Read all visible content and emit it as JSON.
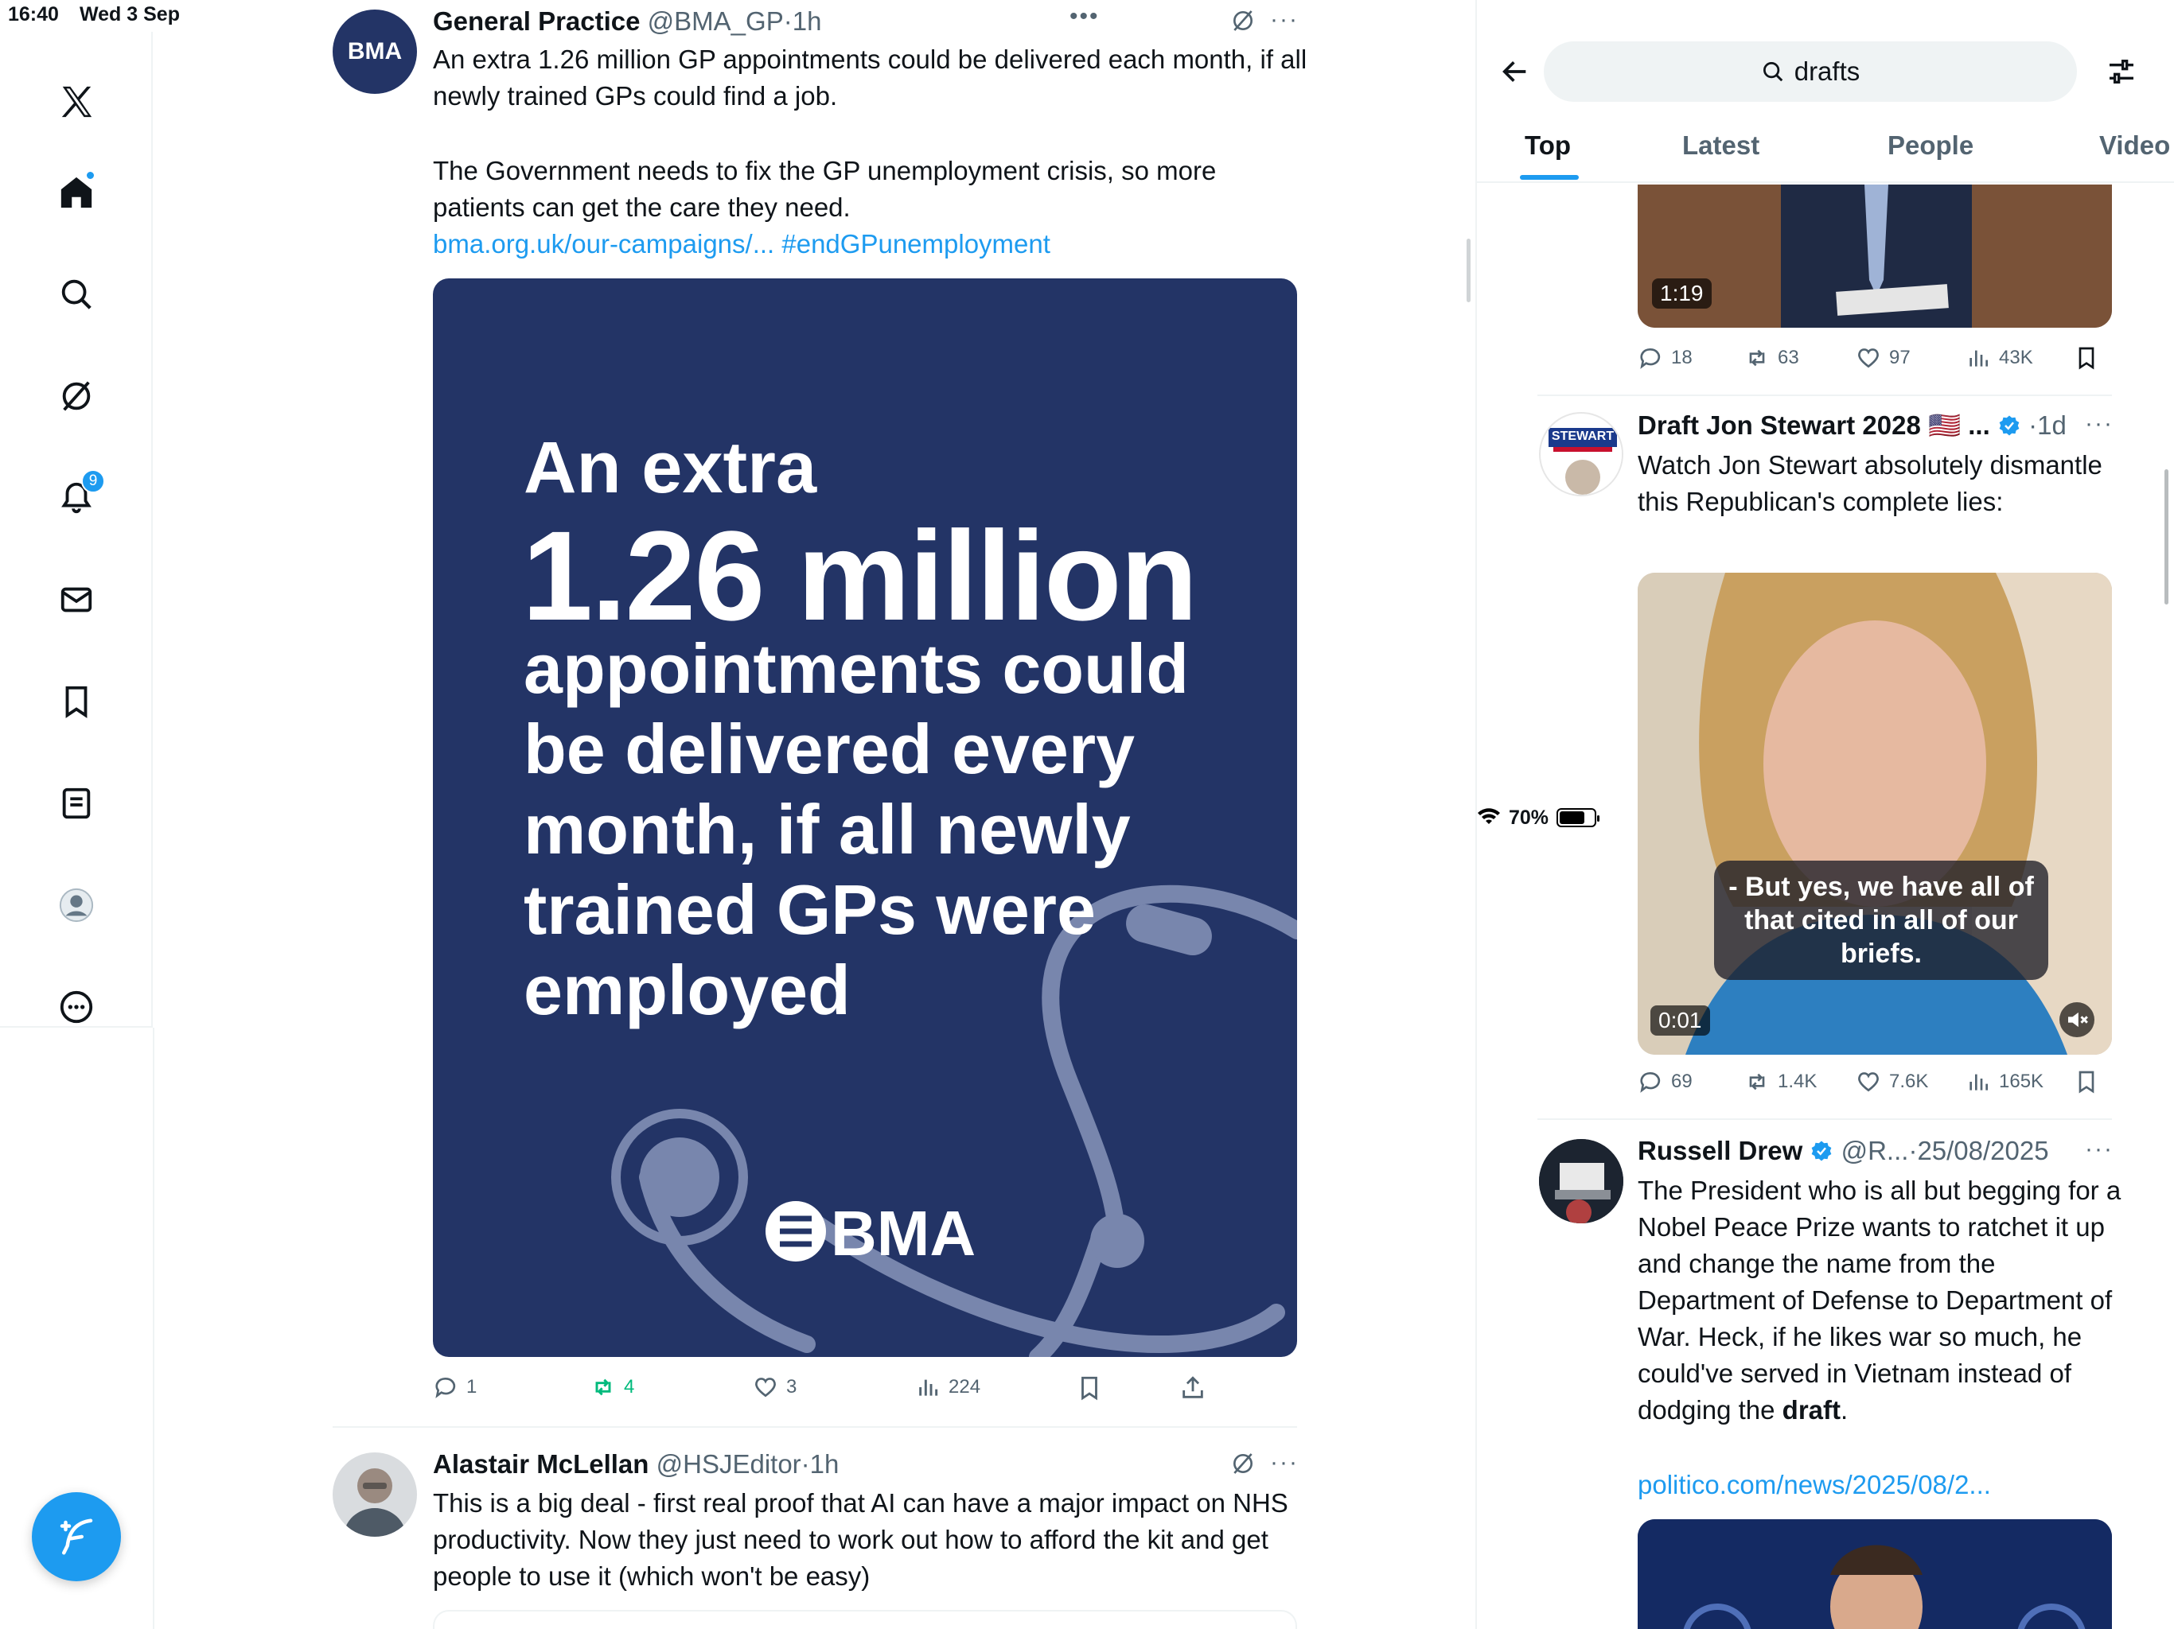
{
  "status": {
    "time": "16:40",
    "date": "Wed 3 Sep",
    "battery": "70%"
  },
  "nav": {
    "notifications_badge": "9"
  },
  "tweet1": {
    "name": "General Practice",
    "handle": "@BMA_GP",
    "time": "1h",
    "avatar_text": "BMA",
    "text1": "An extra 1.26 million GP appointments could be delivered each month, if all newly trained GPs could find a job.",
    "text2": "The Government needs to fix the GP unemployment crisis, so more patients can get the care they need.",
    "link": "bma.org.uk/our-campaigns/...",
    "hashtag": "#endGPunemployment",
    "card": {
      "line1": "An extra",
      "line2": "1.26 million",
      "line3": "appointments could be delivered every month, if all newly trained GPs were employed",
      "logo": "BMA"
    },
    "stats": {
      "replies": "1",
      "reposts": "4",
      "likes": "3",
      "views": "224"
    }
  },
  "tweet2": {
    "name": "Alastair McLellan",
    "handle": "@HSJEditor",
    "time": "1h",
    "text": "This is a big deal - first real proof that AI can have a major impact on NHS productivity. Now they just need to work out how to afford the kit and get people to use it (which won't be easy)"
  },
  "search": {
    "query": "drafts"
  },
  "tabs": [
    "Top",
    "Latest",
    "People",
    "Video"
  ],
  "r0": {
    "video_time": "1:19",
    "stats": {
      "replies": "18",
      "reposts": "63",
      "likes": "97",
      "views": "43K"
    }
  },
  "r1": {
    "name": "Draft Jon Stewart 2028",
    "flag": "🇺🇸 ...",
    "time": "1d",
    "text": "Watch Jon Stewart absolutely dismantle this Republican's complete lies:",
    "avatar_text": "STEWART",
    "subtitle": "- But yes, we have all of that cited in all of our briefs.",
    "video_time": "0:01",
    "stats": {
      "replies": "69",
      "reposts": "1.4K",
      "likes": "7.6K",
      "views": "165K"
    }
  },
  "r2": {
    "name": "Russell Drew",
    "handle": "@R...",
    "time": "25/08/2025",
    "text_before": "The President who is all but begging for a Nobel Peace Prize wants to ratchet it up and change the name from the Department of Defense to Department of War. Heck, if he likes war so much, he could've served in Vietnam instead of dodging the ",
    "text_bold": "draft",
    "text_after": ".",
    "link": "politico.com/news/2025/08/2..."
  },
  "colors": {
    "accent": "#1d9bf0",
    "bma_navy": "#233466",
    "repost_green": "#00ba7c"
  }
}
